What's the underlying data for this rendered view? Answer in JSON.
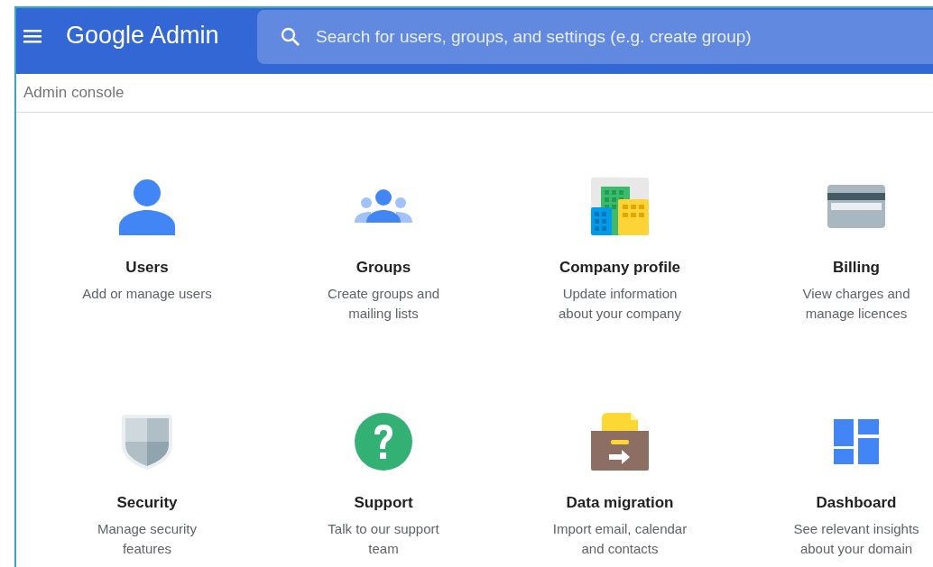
{
  "header": {
    "logo": "Google Admin",
    "search": {
      "placeholder": "Search for users, groups, and settings (e.g. create group)"
    }
  },
  "breadcrumb": "Admin console",
  "cards": [
    {
      "title": "Users",
      "description": "Add or manage users"
    },
    {
      "title": "Groups",
      "description": "Create groups and mailing lists"
    },
    {
      "title": "Company profile",
      "description": "Update information about your company"
    },
    {
      "title": "Billing",
      "description": "View charges and manage licences"
    },
    {
      "title": "Security",
      "description": "Manage security features"
    },
    {
      "title": "Support",
      "description": "Talk to our support team"
    },
    {
      "title": "Data migration",
      "description": "Import email, calendar and contacts"
    },
    {
      "title": "Dashboard",
      "description": "See relevant insights about your domain"
    }
  ]
}
